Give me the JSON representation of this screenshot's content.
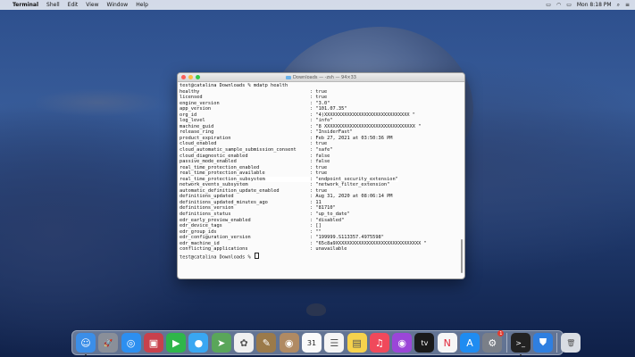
{
  "menubar": {
    "app": "Terminal",
    "items": [
      "Shell",
      "Edit",
      "View",
      "Window",
      "Help"
    ],
    "clock": "Mon 8:18 PM"
  },
  "window": {
    "title": "Downloads — -zsh — 94×33"
  },
  "terminal": {
    "command_line": "test@catalina Downloads % mdatp health",
    "rows": [
      {
        "key": "healthy",
        "value": "true"
      },
      {
        "key": "licensed",
        "value": "true"
      },
      {
        "key": "engine_version",
        "value": "\"3.0\""
      },
      {
        "key": "app_version",
        "value": "\"101.07.35\""
      },
      {
        "key": "org_id",
        "value": "\"4)XXXXXXXXXXXXXXXXXXXXXXXXXXXXXX \""
      },
      {
        "key": "log_level",
        "value": "\"info\""
      },
      {
        "key": "machine_guid",
        "value": "\"8 XXXXXXXXXXXXXXXXXXXXXXXXXXXXXXXX \""
      },
      {
        "key": "release_ring",
        "value": "\"InsiderFast\""
      },
      {
        "key": "product_expiration",
        "value": "Feb 27, 2021 at 03:50:36 PM"
      },
      {
        "key": "cloud_enabled",
        "value": "true"
      },
      {
        "key": "cloud_automatic_sample_submission_consent",
        "value": "\"safe\""
      },
      {
        "key": "cloud_diagnostic_enabled",
        "value": "false"
      },
      {
        "key": "passive_mode_enabled",
        "value": "false"
      },
      {
        "key": "real_time_protection_enabled",
        "value": "true"
      },
      {
        "key": "real_time_protection_available",
        "value": "true"
      },
      {
        "key": "real_time_protection_subsystem",
        "value": "\"endpoint_security_extension\""
      },
      {
        "key": "network_events_subsystem",
        "value": "\"network_filter_extension\""
      },
      {
        "key": "automatic_definition_update_enabled",
        "value": "true"
      },
      {
        "key": "definitions_updated",
        "value": "Aug 31, 2020 at 08:06:14 PM"
      },
      {
        "key": "definitions_updated_minutes_ago",
        "value": "11"
      },
      {
        "key": "definitions_version",
        "value": "\"81710\""
      },
      {
        "key": "definitions_status",
        "value": "\"up_to_date\""
      },
      {
        "key": "edr_early_preview_enabled",
        "value": "\"disabled\""
      },
      {
        "key": "edr_device_tags",
        "value": "[]"
      },
      {
        "key": "edr_group_ids",
        "value": "\"\""
      },
      {
        "key": "edr_configuration_version",
        "value": "\"199999.S113357.4975598\""
      },
      {
        "key": "edr_machine_id",
        "value": "\"65c8a9XXXXXXXXXXXXXXXXXXXXXXXXXXXXXX \""
      },
      {
        "key": "conflicting_applications",
        "value": "unavailable"
      }
    ],
    "separator": ": ",
    "prompt": "test@catalina Downloads %"
  },
  "dock": {
    "apps": [
      {
        "name": "finder-icon",
        "glyph": "☺",
        "color": "#3b8ee8"
      },
      {
        "name": "launchpad-icon",
        "glyph": "🚀",
        "color": "#8a8f99"
      },
      {
        "name": "safari-icon",
        "glyph": "◎",
        "color": "#2d8ff0"
      },
      {
        "name": "photo-booth-icon",
        "glyph": "▣",
        "color": "#c8414c"
      },
      {
        "name": "facetime-icon",
        "glyph": "▶",
        "color": "#2fb64a"
      },
      {
        "name": "messages-icon",
        "glyph": "●",
        "color": "#3aa7f2"
      },
      {
        "name": "maps-icon",
        "glyph": "➤",
        "color": "#5aa65a"
      },
      {
        "name": "photos-icon",
        "glyph": "✿",
        "color": "#f0f0f0"
      },
      {
        "name": "notes-brown-icon",
        "glyph": "✎",
        "color": "#9b7a4a"
      },
      {
        "name": "contacts-icon",
        "glyph": "◉",
        "color": "#b08a63"
      },
      {
        "name": "calendar-icon",
        "glyph": "31",
        "color": "#fafafa"
      },
      {
        "name": "reminders-icon",
        "glyph": "☰",
        "color": "#f5f5f5"
      },
      {
        "name": "notes-icon",
        "glyph": "▤",
        "color": "#f6d24c"
      },
      {
        "name": "music-icon",
        "glyph": "♫",
        "color": "#f0495b"
      },
      {
        "name": "podcasts-icon",
        "glyph": "◉",
        "color": "#9b46d8"
      },
      {
        "name": "apple-tv-icon",
        "glyph": "tv",
        "color": "#1a1a1a"
      },
      {
        "name": "news-icon",
        "glyph": "N",
        "color": "#f6f6f6"
      },
      {
        "name": "app-store-icon",
        "glyph": "A",
        "color": "#1f8cf1"
      },
      {
        "name": "system-preferences-icon",
        "glyph": "⚙",
        "color": "#7a7f88"
      }
    ],
    "recent": [
      {
        "name": "terminal-icon",
        "glyph": ">_",
        "color": "#222"
      },
      {
        "name": "defender-icon",
        "glyph": "⛊",
        "color": "#2f7fe0"
      }
    ],
    "trash": {
      "name": "trash-icon",
      "glyph": "🗑",
      "color": "#d9dde3"
    },
    "calendar_day": "31",
    "sysprefs_badge": "1"
  }
}
